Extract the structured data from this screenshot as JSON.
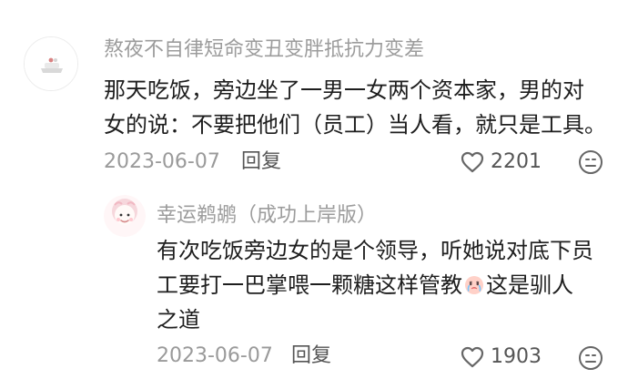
{
  "comments": [
    {
      "username": "熬夜不自律短命变丑变胖抵抗力变差",
      "content": {
        "line1": "那天吃饭，旁边坐了一男一女两个资本家，男的对",
        "line2": "女的说：不要把他们（员工）当人看，就只是工具。"
      },
      "date": "2023-06-07",
      "reply_label": "回复",
      "likes": "2201",
      "avatar_icon": "white-tray-avatar-icon",
      "like_icon": "heart-outline-icon",
      "dislike_icon": "neutral-face-icon"
    },
    {
      "username": "幸运鹈鹕（成功上岸版）",
      "content": {
        "line1": "有次吃饭旁边女的是个领导，听她说对底下员",
        "line2_before_emoji": "工要打一巴掌喂一颗糖这样管教",
        "line2_after_emoji": "这是驯人",
        "line3": "之道"
      },
      "date": "2023-06-07",
      "reply_label": "回复",
      "likes": "1903",
      "avatar_icon": "pink-character-avatar-icon",
      "emoji_icon": "crying-face-emoji-icon",
      "like_icon": "heart-outline-icon",
      "dislike_icon": "neutral-face-icon"
    }
  ]
}
